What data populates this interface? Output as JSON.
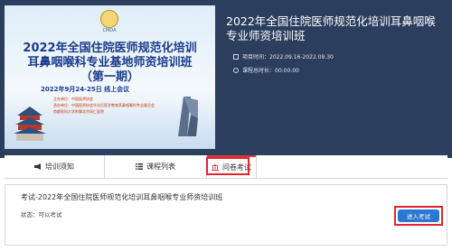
{
  "banner": {
    "logo_text": "CMDA",
    "headline_1": "2022年全国住院医师规范化培训",
    "headline_2": "耳鼻咽喉科专业基地师资培训班",
    "headline_3": "（第一期）",
    "date_line": "2022年9月24-25日   线上会议",
    "organizer_1": "主办单位：中国医师协会",
    "organizer_2": "承办单位：中国医师协会毕业后医学教育耳鼻咽喉科专业委员会",
    "organizer_3": "首都医科大学附属北京同仁医院"
  },
  "course": {
    "title": "2022年全国住院医师规范化培训耳鼻咽喉专业师资培训班",
    "project_time": "项目时间：2022.09.16-2022.09.30",
    "total_duration": "课程总时长：00:00:00"
  },
  "tabs": [
    {
      "label": "培训须知",
      "icon": "megaphone-icon"
    },
    {
      "label": "课程列表",
      "icon": "list-icon"
    },
    {
      "label": "问卷考试",
      "icon": "bank-icon",
      "active": true
    }
  ],
  "exam": {
    "name": "考试-2022年全国住院医师规范化培训耳鼻咽喉专业师资培训班",
    "status": "状态：可以考试",
    "enter_label": "进入考试"
  },
  "colors": {
    "header_bg": "#2b3e5d",
    "accent_red": "#e4232f",
    "button_blue": "#2a78d0"
  }
}
